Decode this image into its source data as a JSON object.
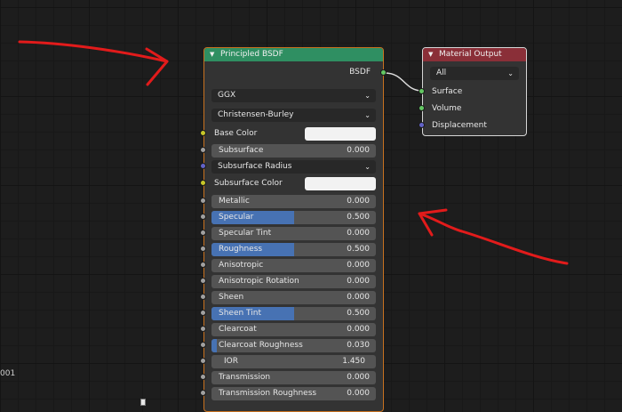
{
  "side_text": "001",
  "bsdf_node": {
    "title": "Principled BSDF",
    "output_label": "BSDF",
    "distribution": "GGX",
    "subsurface_method": "Christensen-Burley",
    "base_color_label": "Base Color",
    "subsurface_label": "Subsurface",
    "subsurface_value": "0.000",
    "subsurface_radius_label": "Subsurface Radius",
    "subsurface_color_label": "Subsurface Color",
    "params": [
      {
        "label": "Metallic",
        "value": "0.000",
        "fill": 0
      },
      {
        "label": "Specular",
        "value": "0.500",
        "fill": 0.5
      },
      {
        "label": "Specular Tint",
        "value": "0.000",
        "fill": 0
      },
      {
        "label": "Roughness",
        "value": "0.500",
        "fill": 0.5
      },
      {
        "label": "Anisotropic",
        "value": "0.000",
        "fill": 0
      },
      {
        "label": "Anisotropic Rotation",
        "value": "0.000",
        "fill": 0
      },
      {
        "label": "Sheen",
        "value": "0.000",
        "fill": 0
      },
      {
        "label": "Sheen Tint",
        "value": "0.500",
        "fill": 0.5
      },
      {
        "label": "Clearcoat",
        "value": "0.000",
        "fill": 0
      },
      {
        "label": "Clearcoat Roughness",
        "value": "0.030",
        "fill": 0.03
      },
      {
        "label": "IOR",
        "value": "1.450",
        "fill": 0
      },
      {
        "label": "Transmission",
        "value": "0.000",
        "fill": 0
      },
      {
        "label": "Transmission Roughness",
        "value": "0.000",
        "fill": 0
      }
    ]
  },
  "output_node": {
    "title": "Material Output",
    "target": "All",
    "inputs": [
      "Surface",
      "Volume",
      "Displacement"
    ]
  },
  "colors": {
    "bsdf_header": "#2f8f62",
    "output_header": "#8a2f38",
    "slider_fill": "#4772b3",
    "annotation_red": "#e21b1b"
  }
}
